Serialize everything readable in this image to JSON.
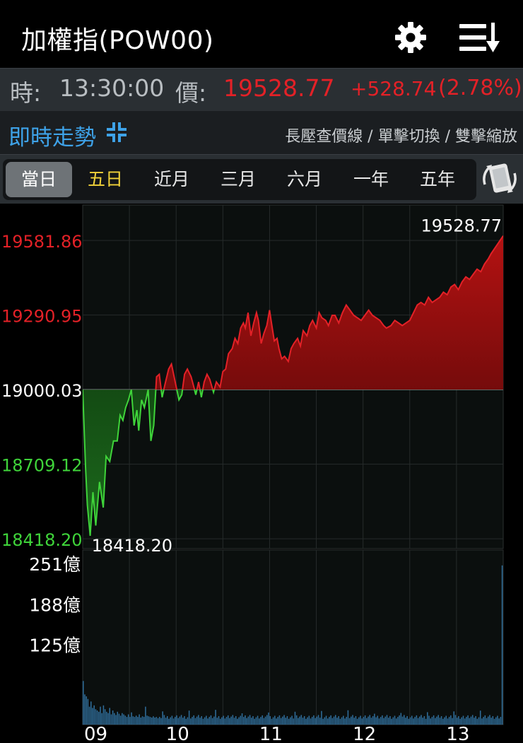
{
  "header": {
    "title": "加權指(POW00)"
  },
  "icons": {
    "settings": "gear-icon",
    "menu": "sort-menu-icon",
    "mode": "compress-icon",
    "rotate": "rotate-screen-icon"
  },
  "quote": {
    "time_label": "時:",
    "time": "13:30:00",
    "price_label": "價:",
    "price": "19528.77",
    "change": "+528.74",
    "change_pct": "(2.78%)"
  },
  "mode": {
    "title": "即時走勢",
    "hint": "長壓查價線 / 單擊切換 / 雙擊縮放"
  },
  "tabs": [
    {
      "label": "當日",
      "active": true
    },
    {
      "label": "五日",
      "highlight": true
    },
    {
      "label": "近月"
    },
    {
      "label": "三月"
    },
    {
      "label": "六月"
    },
    {
      "label": "一年"
    },
    {
      "label": "五年"
    }
  ],
  "colors": {
    "up": "#e32127",
    "down": "#3fd43a",
    "accent": "#3ea2e8",
    "highlight": "#f2d33a"
  },
  "chart_data": {
    "type": "area",
    "reference": 19000.03,
    "y_ticks": [
      {
        "label": "19581.86",
        "value": 19581.86,
        "dir": "up"
      },
      {
        "label": "19290.95",
        "value": 19290.95,
        "dir": "up"
      },
      {
        "label": "19000.03",
        "value": 19000.03,
        "dir": "flat"
      },
      {
        "label": "18709.12",
        "value": 18709.12,
        "dir": "down"
      },
      {
        "label": "18418.20",
        "value": 18418.2,
        "dir": "down"
      }
    ],
    "ylim": [
      18380,
      19720
    ],
    "x_ticks": [
      "09",
      "10",
      "11",
      "12",
      "13"
    ],
    "high_label": "19528.77",
    "low_label": "18418.20",
    "price": [
      [
        0,
        19000
      ],
      [
        0.03,
        18700
      ],
      [
        0.05,
        18550
      ],
      [
        0.08,
        18430
      ],
      [
        0.11,
        18600
      ],
      [
        0.14,
        18470
      ],
      [
        0.18,
        18640
      ],
      [
        0.22,
        18540
      ],
      [
        0.25,
        18740
      ],
      [
        0.29,
        18720
      ],
      [
        0.33,
        18800
      ],
      [
        0.37,
        18800
      ],
      [
        0.4,
        18900
      ],
      [
        0.43,
        18880
      ],
      [
        0.46,
        18930
      ],
      [
        0.49,
        18960
      ],
      [
        0.52,
        19000
      ],
      [
        0.55,
        18860
      ],
      [
        0.58,
        18920
      ],
      [
        0.6,
        18840
      ],
      [
        0.63,
        18960
      ],
      [
        0.66,
        18930
      ],
      [
        0.7,
        19000
      ],
      [
        0.73,
        18800
      ],
      [
        0.76,
        18860
      ],
      [
        0.79,
        19050
      ],
      [
        0.82,
        19060
      ],
      [
        0.85,
        18970
      ],
      [
        0.88,
        19020
      ],
      [
        0.92,
        19080
      ],
      [
        0.95,
        19100
      ],
      [
        0.99,
        19030
      ],
      [
        1.03,
        18960
      ],
      [
        1.06,
        18980
      ],
      [
        1.09,
        19060
      ],
      [
        1.12,
        19080
      ],
      [
        1.16,
        19050
      ],
      [
        1.19,
        19010
      ],
      [
        1.21,
        18980
      ],
      [
        1.24,
        19030
      ],
      [
        1.27,
        18970
      ],
      [
        1.3,
        19030
      ],
      [
        1.33,
        19060
      ],
      [
        1.36,
        19040
      ],
      [
        1.4,
        18990
      ],
      [
        1.43,
        19030
      ],
      [
        1.47,
        19010
      ],
      [
        1.5,
        19070
      ],
      [
        1.53,
        19080
      ],
      [
        1.56,
        19140
      ],
      [
        1.6,
        19160
      ],
      [
        1.63,
        19200
      ],
      [
        1.66,
        19180
      ],
      [
        1.69,
        19240
      ],
      [
        1.72,
        19260
      ],
      [
        1.74,
        19240
      ],
      [
        1.77,
        19300
      ],
      [
        1.8,
        19210
      ],
      [
        1.83,
        19260
      ],
      [
        1.86,
        19300
      ],
      [
        1.88,
        19270
      ],
      [
        1.91,
        19180
      ],
      [
        1.94,
        19220
      ],
      [
        1.97,
        19250
      ],
      [
        2.0,
        19310
      ],
      [
        2.02,
        19260
      ],
      [
        2.05,
        19190
      ],
      [
        2.08,
        19200
      ],
      [
        2.1,
        19160
      ],
      [
        2.13,
        19120
      ],
      [
        2.16,
        19130
      ],
      [
        2.2,
        19110
      ],
      [
        2.23,
        19160
      ],
      [
        2.26,
        19180
      ],
      [
        2.3,
        19200
      ],
      [
        2.33,
        19170
      ],
      [
        2.36,
        19230
      ],
      [
        2.4,
        19210
      ],
      [
        2.43,
        19250
      ],
      [
        2.46,
        19270
      ],
      [
        2.5,
        19240
      ],
      [
        2.53,
        19300
      ],
      [
        2.56,
        19280
      ],
      [
        2.6,
        19270
      ],
      [
        2.63,
        19250
      ],
      [
        2.67,
        19290
      ],
      [
        2.7,
        19290
      ],
      [
        2.74,
        19260
      ],
      [
        2.78,
        19300
      ],
      [
        2.82,
        19330
      ],
      [
        2.86,
        19310
      ],
      [
        2.9,
        19290
      ],
      [
        2.94,
        19280
      ],
      [
        2.98,
        19270
      ],
      [
        3.02,
        19290
      ],
      [
        3.06,
        19310
      ],
      [
        3.1,
        19290
      ],
      [
        3.14,
        19280
      ],
      [
        3.18,
        19270
      ],
      [
        3.22,
        19250
      ],
      [
        3.25,
        19240
      ],
      [
        3.3,
        19250
      ],
      [
        3.34,
        19270
      ],
      [
        3.38,
        19260
      ],
      [
        3.42,
        19250
      ],
      [
        3.46,
        19260
      ],
      [
        3.5,
        19270
      ],
      [
        3.54,
        19300
      ],
      [
        3.58,
        19330
      ],
      [
        3.62,
        19340
      ],
      [
        3.66,
        19330
      ],
      [
        3.7,
        19360
      ],
      [
        3.74,
        19340
      ],
      [
        3.78,
        19350
      ],
      [
        3.82,
        19360
      ],
      [
        3.86,
        19380
      ],
      [
        3.9,
        19370
      ],
      [
        3.94,
        19400
      ],
      [
        3.98,
        19410
      ],
      [
        4.02,
        19390
      ],
      [
        4.06,
        19420
      ],
      [
        4.1,
        19440
      ],
      [
        4.14,
        19430
      ],
      [
        4.18,
        19450
      ],
      [
        4.22,
        19470
      ],
      [
        4.26,
        19460
      ],
      [
        4.3,
        19490
      ],
      [
        4.34,
        19510
      ],
      [
        4.37,
        19530
      ],
      [
        4.5,
        19600
      ]
    ],
    "volume_ticks": [
      {
        "label": "251億",
        "value": 251
      },
      {
        "label": "188億",
        "value": 188
      },
      {
        "label": "125億",
        "value": 125
      }
    ],
    "volume_max": 272,
    "volume_first": [
      68,
      47,
      44,
      40,
      28,
      36,
      26,
      30,
      24,
      22,
      20,
      28,
      18,
      30,
      24,
      20,
      18,
      26,
      16,
      22,
      18,
      15,
      20,
      17,
      14,
      18,
      16,
      14,
      12,
      16,
      12,
      19,
      13,
      12,
      14,
      12,
      16,
      11,
      13,
      12,
      28,
      14,
      13,
      12,
      11,
      13,
      11,
      12,
      10,
      12
    ],
    "volume_level": 9,
    "volume_last": 248
  }
}
